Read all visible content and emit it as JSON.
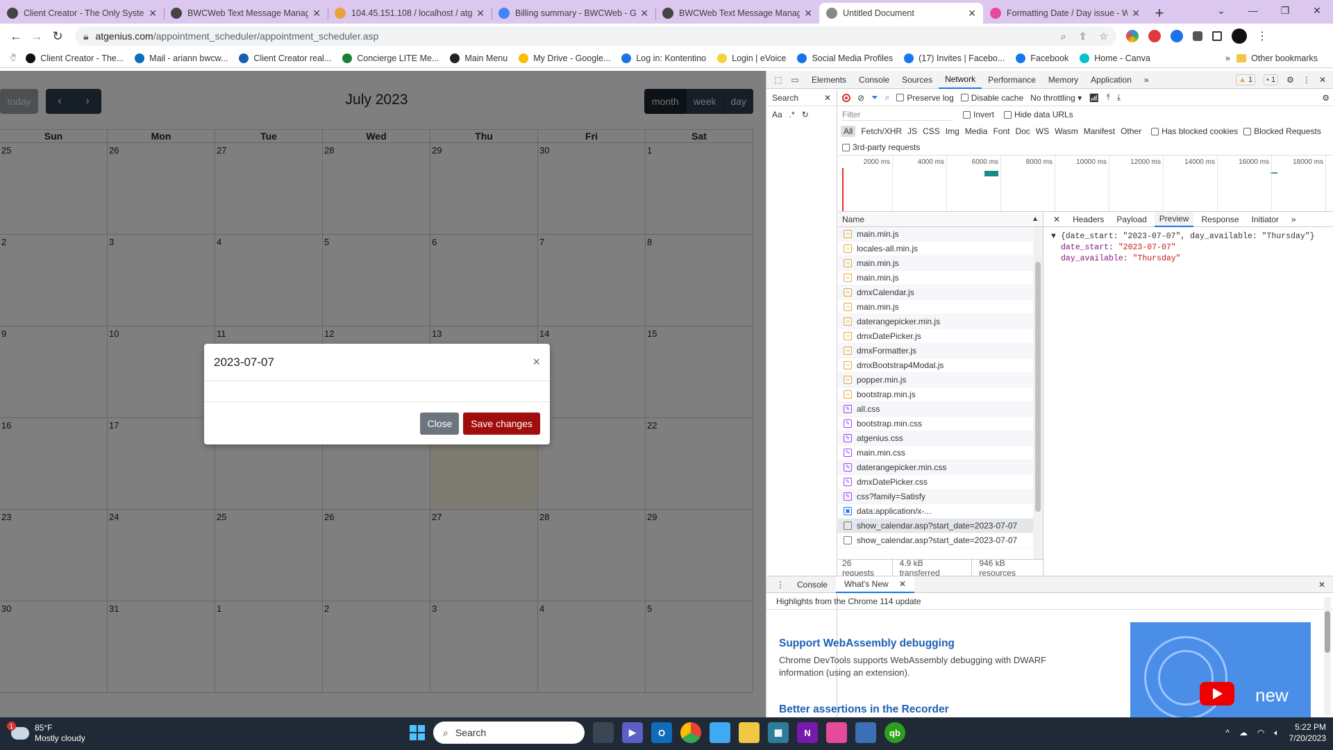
{
  "browser": {
    "tabs": [
      {
        "title": "Client Creator - The Only System",
        "color": "#444444"
      },
      {
        "title": "BWCWeb Text Message Manager",
        "color": "#444444"
      },
      {
        "title": "104.45.151.108 / localhost / atge",
        "color": "#e8a33d"
      },
      {
        "title": "Billing summary - BWCWeb - Go",
        "color": "#4285f4"
      },
      {
        "title": "BWCWeb Text Message Manager",
        "color": "#444444"
      },
      {
        "title": "Untitled Document",
        "color": "#888888"
      },
      {
        "title": "Formatting Date / Day issue - W",
        "color": "#e64a9a"
      }
    ],
    "active_tab": 5,
    "new_tab": "+",
    "url_domain": "atgenius.com",
    "url_path": "/appointment_scheduler/appointment_scheduler.asp",
    "bookmarks": [
      {
        "label": "Client Creator - The...",
        "color": "#111111"
      },
      {
        "label": "Mail - ariann bwcw...",
        "color": "#0f6cbd"
      },
      {
        "label": "Client Creator real...",
        "color": "#1a5fb4"
      },
      {
        "label": "Concierge LITE Me...",
        "color": "#188038"
      },
      {
        "label": "Main Menu",
        "color": "#222222"
      },
      {
        "label": "My Drive - Google...",
        "color": "#fbbc04"
      },
      {
        "label": "Log in: Kontentino",
        "color": "#1a73e8"
      },
      {
        "label": "Login | eVoice",
        "color": "#f5d33b"
      },
      {
        "label": "Social Media Profiles",
        "color": "#1a73e8"
      },
      {
        "label": "(17) Invites | Facebo...",
        "color": "#1877f2"
      },
      {
        "label": "Facebook",
        "color": "#1877f2"
      },
      {
        "label": "Home - Canva",
        "color": "#00c4cc"
      }
    ],
    "other_bookmarks": "Other bookmarks",
    "more": "»"
  },
  "calendar": {
    "today_label": "today",
    "prev": "‹",
    "next": "›",
    "title": "July 2023",
    "views": [
      "month",
      "week",
      "day"
    ],
    "weekdays": [
      "Sun",
      "Mon",
      "Tue",
      "Wed",
      "Thu",
      "Fri",
      "Sat"
    ],
    "weeks": [
      [
        "25",
        "26",
        "27",
        "28",
        "29",
        "30",
        "1"
      ],
      [
        "2",
        "3",
        "4",
        "5",
        "6",
        "7",
        "8"
      ],
      [
        "9",
        "10",
        "11",
        "12",
        "13",
        "14",
        "15"
      ],
      [
        "16",
        "17",
        "18",
        "19",
        "20",
        "21",
        "22"
      ],
      [
        "23",
        "24",
        "25",
        "26",
        "27",
        "28",
        "29"
      ],
      [
        "30",
        "31",
        "1",
        "2",
        "3",
        "4",
        "5"
      ]
    ],
    "highlight": {
      "week": 3,
      "day": 4
    }
  },
  "modal": {
    "title": "2023-07-07",
    "close_x": "×",
    "close_label": "Close",
    "save_label": "Save changes"
  },
  "devtools": {
    "tabs": [
      "Elements",
      "Console",
      "Sources",
      "Network",
      "Performance",
      "Memory",
      "Application"
    ],
    "active_tab": "Network",
    "warnings": "1",
    "messages": "1",
    "search_label": "Search",
    "aa": "Aa",
    "regex": ".*",
    "preserve_log": "Preserve log",
    "disable_cache": "Disable cache",
    "throttling": "No throttling",
    "filter_placeholder": "Filter",
    "invert": "Invert",
    "hide_data_urls": "Hide data URLs",
    "types": [
      "All",
      "Fetch/XHR",
      "JS",
      "CSS",
      "Img",
      "Media",
      "Font",
      "Doc",
      "WS",
      "Wasm",
      "Manifest",
      "Other"
    ],
    "has_blocked_cookies": "Has blocked cookies",
    "blocked_requests": "Blocked Requests",
    "third_party": "3rd-party requests",
    "timeline_ticks": [
      "2000 ms",
      "4000 ms",
      "6000 ms",
      "8000 ms",
      "10000 ms",
      "12000 ms",
      "14000 ms",
      "16000 ms",
      "18000 ms"
    ],
    "name_header": "Name",
    "requests": [
      {
        "name": "main.min.js",
        "kind": "js"
      },
      {
        "name": "locales-all.min.js",
        "kind": "js"
      },
      {
        "name": "main.min.js",
        "kind": "js"
      },
      {
        "name": "main.min.js",
        "kind": "js"
      },
      {
        "name": "dmxCalendar.js",
        "kind": "js"
      },
      {
        "name": "main.min.js",
        "kind": "js"
      },
      {
        "name": "daterangepicker.min.js",
        "kind": "js"
      },
      {
        "name": "dmxDatePicker.js",
        "kind": "js"
      },
      {
        "name": "dmxFormatter.js",
        "kind": "js"
      },
      {
        "name": "dmxBootstrap4Modal.js",
        "kind": "js"
      },
      {
        "name": "popper.min.js",
        "kind": "js"
      },
      {
        "name": "bootstrap.min.js",
        "kind": "js"
      },
      {
        "name": "all.css",
        "kind": "css"
      },
      {
        "name": "bootstrap.min.css",
        "kind": "css"
      },
      {
        "name": "atgenius.css",
        "kind": "css"
      },
      {
        "name": "main.min.css",
        "kind": "css"
      },
      {
        "name": "daterangepicker.min.css",
        "kind": "css"
      },
      {
        "name": "dmxDatePicker.css",
        "kind": "css"
      },
      {
        "name": "css?family=Satisfy",
        "kind": "css"
      },
      {
        "name": "data:application/x-...",
        "kind": "data"
      },
      {
        "name": "show_calendar.asp?start_date=2023-07-07",
        "kind": "doc"
      },
      {
        "name": "show_calendar.asp?start_date=2023-07-07",
        "kind": "doc"
      }
    ],
    "selected_request": 20,
    "status": [
      "26 requests",
      "4.9 kB transferred",
      "946 kB resources"
    ],
    "detail_tabs": [
      "Headers",
      "Payload",
      "Preview",
      "Response",
      "Initiator"
    ],
    "detail_active": "Preview",
    "preview_summary": "{date_start: \"2023-07-07\", day_available: \"Thursday\"}",
    "preview_fields": [
      {
        "key": "date_start",
        "value": "\"2023-07-07\""
      },
      {
        "key": "day_available",
        "value": "\"Thursday\""
      }
    ],
    "drawer_tabs": [
      "Console",
      "What's New"
    ],
    "drawer_active": "What's New",
    "highlights": "Highlights from the Chrome 114 update",
    "wn_heading1": "Support WebAssembly debugging",
    "wn_text1": "Chrome DevTools supports WebAssembly debugging with DWARF information (using an extension).",
    "wn_heading2": "Better assertions in the Recorder",
    "wn_image_text": "new"
  },
  "taskbar": {
    "temp": "85°F",
    "condition": "Mostly cloudy",
    "weather_badge": "1",
    "search": "Search",
    "time": "5:22 PM",
    "date": "7/20/2023"
  }
}
